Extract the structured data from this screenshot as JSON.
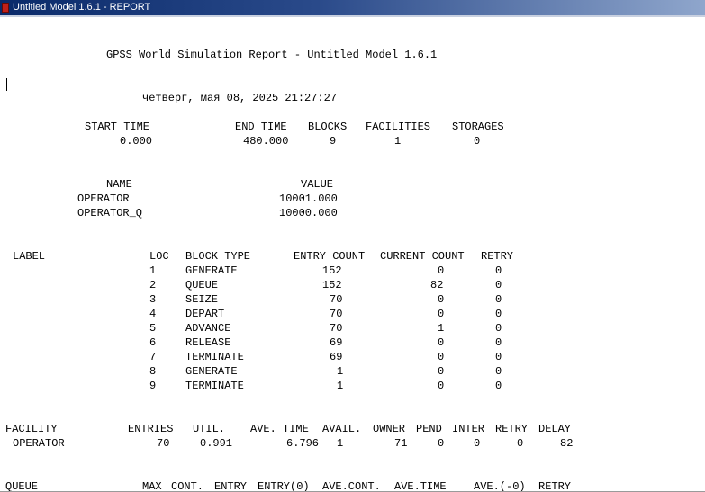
{
  "window": {
    "title": "Untitled Model 1.6.1 - REPORT"
  },
  "report": {
    "title": "GPSS World Simulation Report - Untitled Model 1.6.1",
    "date": "четверг, мая 08, 2025 21:27:27",
    "summary": {
      "headers": [
        "START TIME",
        "END TIME",
        "BLOCKS",
        "FACILITIES",
        "STORAGES"
      ],
      "values": [
        "0.000",
        "480.000",
        "9",
        "1",
        "0"
      ]
    },
    "names": {
      "headers": [
        "NAME",
        "VALUE"
      ],
      "rows": [
        [
          "OPERATOR",
          "10001.000"
        ],
        [
          "OPERATOR_Q",
          "10000.000"
        ]
      ]
    },
    "blocks": {
      "headers": [
        "LABEL",
        "LOC",
        "BLOCK TYPE",
        "ENTRY COUNT",
        "CURRENT COUNT",
        "RETRY"
      ],
      "rows": [
        [
          "1",
          "GENERATE",
          "152",
          "0",
          "0"
        ],
        [
          "2",
          "QUEUE",
          "152",
          "82",
          "0"
        ],
        [
          "3",
          "SEIZE",
          "70",
          "0",
          "0"
        ],
        [
          "4",
          "DEPART",
          "70",
          "0",
          "0"
        ],
        [
          "5",
          "ADVANCE",
          "70",
          "1",
          "0"
        ],
        [
          "6",
          "RELEASE",
          "69",
          "0",
          "0"
        ],
        [
          "7",
          "TERMINATE",
          "69",
          "0",
          "0"
        ],
        [
          "8",
          "GENERATE",
          "1",
          "0",
          "0"
        ],
        [
          "9",
          "TERMINATE",
          "1",
          "0",
          "0"
        ]
      ]
    },
    "facility": {
      "headers": [
        "FACILITY",
        "ENTRIES",
        "UTIL.",
        "AVE. TIME",
        "AVAIL.",
        "OWNER",
        "PEND",
        "INTER",
        "RETRY",
        "DELAY"
      ],
      "row": [
        "OPERATOR",
        "70",
        "0.991",
        "6.796",
        "1",
        "71",
        "0",
        "0",
        "0",
        "82"
      ]
    },
    "queue": {
      "headers": [
        "QUEUE",
        "MAX",
        "CONT.",
        "ENTRY",
        "ENTRY(0)",
        "AVE.CONT.",
        "AVE.TIME",
        "AVE.(-0)",
        "RETRY"
      ]
    }
  }
}
